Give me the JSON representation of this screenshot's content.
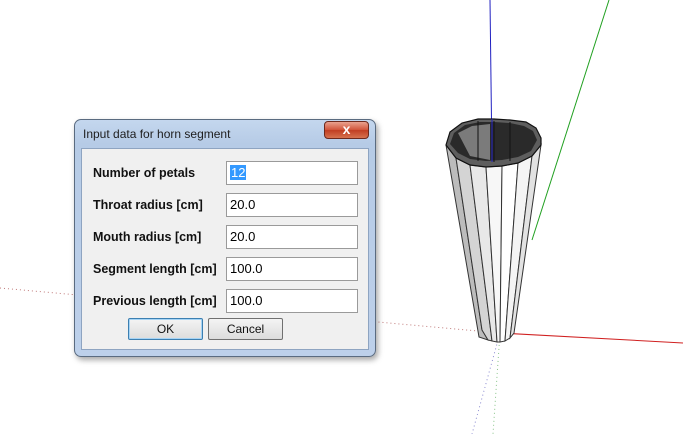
{
  "dialog": {
    "title": "Input data for horn segment",
    "close_label": "x",
    "fields": [
      {
        "label": "Number of petals",
        "value": "12"
      },
      {
        "label": "Throat radius [cm]",
        "value": "20.0"
      },
      {
        "label": "Mouth radius [cm]",
        "value": "20.0"
      },
      {
        "label": "Segment length [cm]",
        "value": "100.0"
      },
      {
        "label": "Previous length [cm]",
        "value": "100.0"
      }
    ],
    "ok_label": "OK",
    "cancel_label": "Cancel"
  },
  "viewport": {
    "axis_colors": {
      "red": "#d02020",
      "green": "#20a020",
      "blue": "#2020c0"
    },
    "model": "horn-segment"
  }
}
